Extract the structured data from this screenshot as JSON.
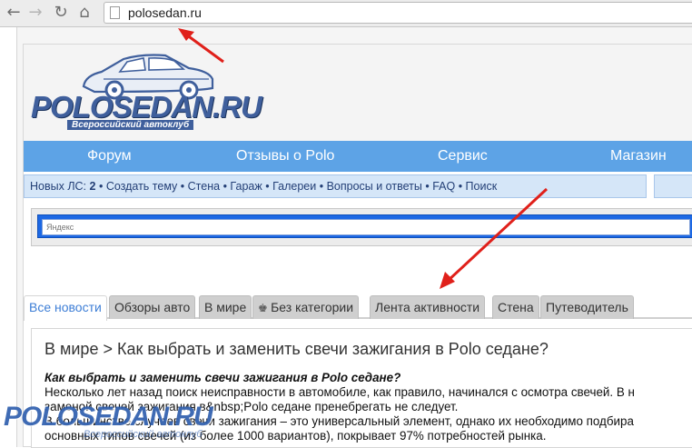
{
  "browser": {
    "url": "polosedan.ru",
    "back_icon": "arrow-left-icon",
    "forward_icon": "arrow-right-icon",
    "reload_icon": "reload-icon",
    "home_icon": "home-icon"
  },
  "site": {
    "logo_text": "POLOSEDAN.RU",
    "logo_subtitle": "Всероссийский автоклуб",
    "menu": [
      "Форум",
      "Отзывы о Polo",
      "Сервис",
      "Магазин"
    ],
    "sub_nav": {
      "new_pm_label": "Новых ЛС:",
      "new_pm_count": "2",
      "links": [
        "Создать тему",
        "Стена",
        "Гараж",
        "Галереи",
        "Вопросы и ответы",
        "FAQ",
        "Поиск"
      ]
    },
    "search_placeholder": "Яндекс",
    "tabs": [
      "Все новости",
      "Обзоры авто",
      "В мире",
      "Без категории",
      "Лента активности",
      "Стена",
      "Путеводитель"
    ],
    "article": {
      "title": "В мире > Как выбрать и заменить свечи зажигания в Polo седане?",
      "subhead": "Как выбрать и заменить свечи зажигания в Polo седане?",
      "lines": [
        "Несколько лет назад поиск неисправности в автомобиле, как правило, начинался с осмотра свечей. В н",
        "заменой свечей зажигания в&nbsp;Polo седане пренебрегать не следует.",
        "В большинстве случаев свечи зажигания – это универсальный элемент, однако их необходимо подбира",
        "основных типов свечей (из более 1000 вариантов), покрывает 97% потребностей рынка."
      ]
    },
    "watermark": {
      "text": "POLOSEDAN.RU",
      "subtitle": "Всероссийский автоклуб"
    }
  },
  "colors": {
    "menu_blue": "#5da3e6",
    "logo_blue": "#3f5f9c",
    "active_tab": "#3d7ed6",
    "arrow_red": "#e0201a"
  }
}
